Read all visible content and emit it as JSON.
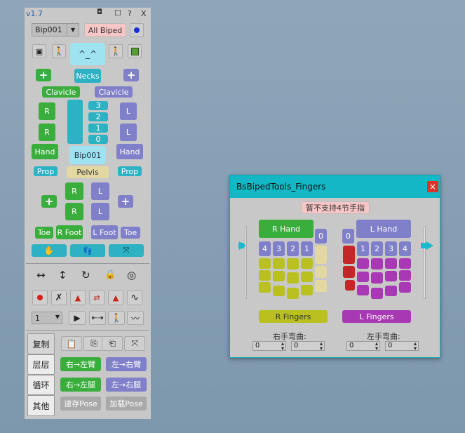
{
  "toolbar": {
    "version": "v1.7",
    "pin_icon": "pin-icon",
    "restore": "☐",
    "help": "?",
    "close": "X"
  },
  "biped": {
    "select_value": "Bip001",
    "all_biped": "All Biped",
    "face": "^_^"
  },
  "labels": {
    "necks": "Necks",
    "r_clavicle": "Clavicle",
    "l_clavicle": "Clavicle",
    "r_upper": "R",
    "r_lower": "R",
    "l_upper": "L",
    "l_lower": "L",
    "spine": [
      "3",
      "2",
      "1",
      "0"
    ],
    "r_hand": "Hand",
    "l_hand": "Hand",
    "bip": "Bip001",
    "r_prop": "Prop",
    "l_prop": "Prop",
    "pelvis": "Pelvis",
    "r_thigh": "R",
    "r_calf": "R",
    "l_thigh": "L",
    "l_calf": "L",
    "r_toe": "Toe",
    "r_foot": "R Foot",
    "l_foot": "L Foot",
    "l_toe": "Toe"
  },
  "lower": {
    "frame_value": "1",
    "tab_copy": "复制",
    "tab_layer": "层层",
    "tab_loop": "循环",
    "tab_other": "其他",
    "r_to_l_arm": "右→左臂",
    "l_to_r_arm": "左→右臂",
    "r_to_l_leg": "右→左腿",
    "l_to_r_leg": "左→右腿",
    "save_pose": "速存Pose",
    "load_pose": "加载Pose"
  },
  "fingers": {
    "title": "BsBipedTools_Fingers",
    "close": "×",
    "notice": "暂不支持4节手指",
    "r_hand": "R Hand",
    "l_hand": "L Hand",
    "r_nums": [
      "4",
      "3",
      "2",
      "1",
      "0"
    ],
    "l_nums": [
      "0",
      "1",
      "2",
      "3",
      "4"
    ],
    "r_fingers": "R Fingers",
    "l_fingers": "L Fingers",
    "r_bend_label": "右手弯曲:",
    "l_bend_label": "左手弯曲:",
    "r_bend_a": "0",
    "r_bend_b": "0",
    "l_bend_a": "0",
    "l_bend_b": "0"
  },
  "colors": {
    "green": "#3aae3c",
    "purple": "#7f7fca",
    "teal": "#2db2c4",
    "olive": "#b9c020",
    "red": "#c4262a",
    "magenta": "#a838b4",
    "titlebar": "#13b7c6"
  }
}
